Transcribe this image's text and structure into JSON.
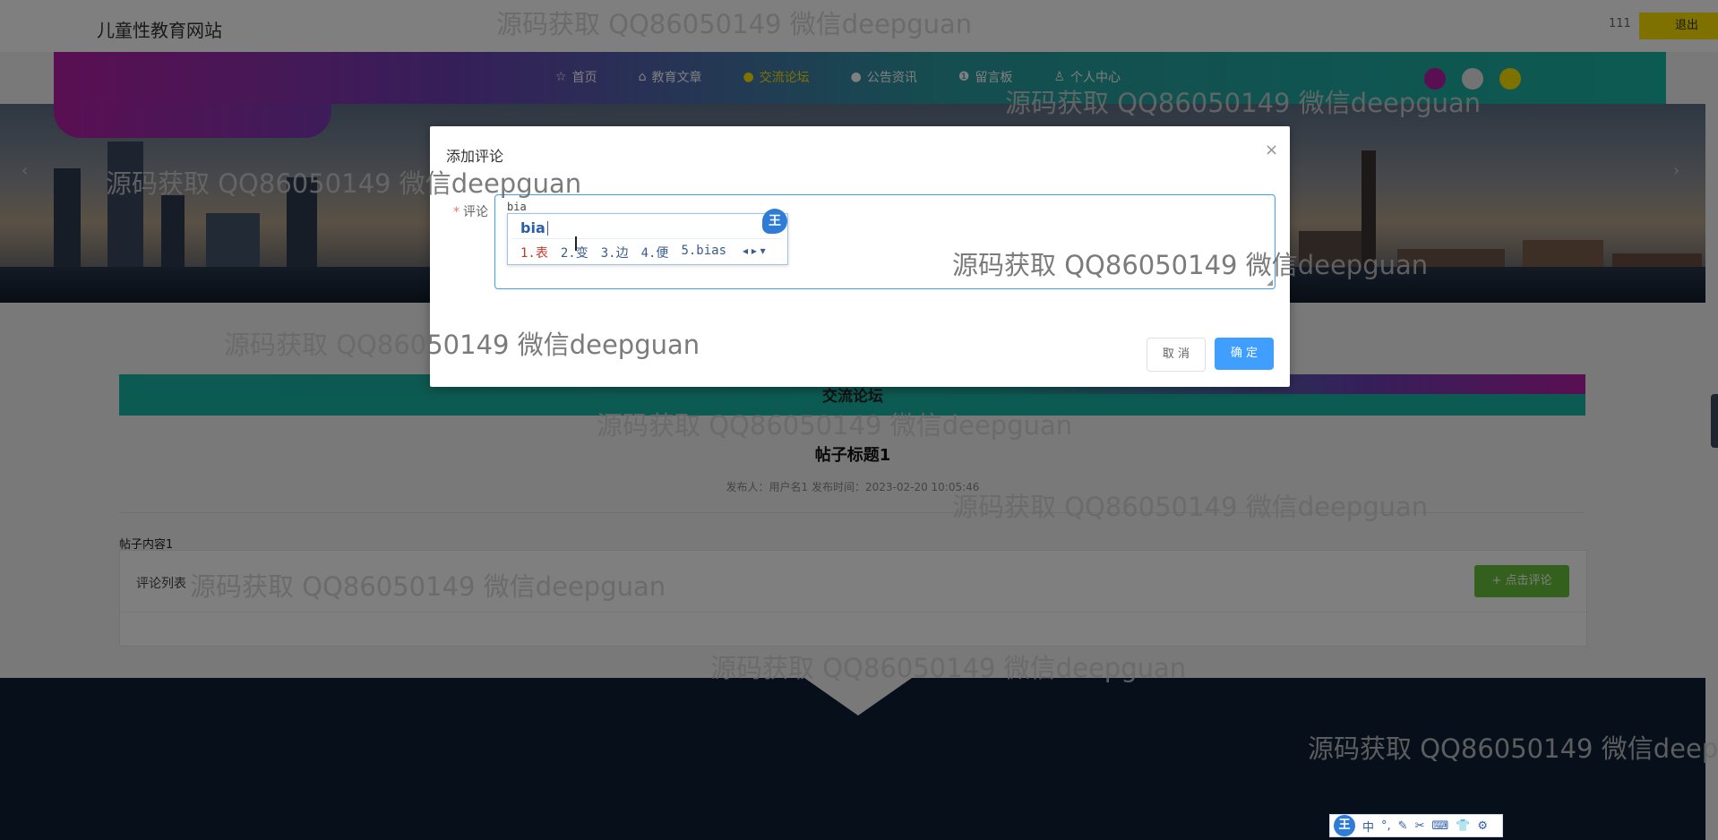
{
  "header": {
    "site_title": "儿童性教育网站",
    "username": "111",
    "logout_label": "退出"
  },
  "nav": {
    "items": [
      {
        "label": "首页",
        "icon": "star-icon"
      },
      {
        "label": "教育文章",
        "icon": "bag-icon"
      },
      {
        "label": "交流论坛",
        "icon": "circle-icon",
        "active": true
      },
      {
        "label": "公告资讯",
        "icon": "circle-icon"
      },
      {
        "label": "留言板",
        "icon": "info-icon"
      },
      {
        "label": "个人中心",
        "icon": "user-icon"
      }
    ],
    "theme_dots": [
      "#b41fa6",
      "#e6e6e6",
      "#ffe200"
    ]
  },
  "banner": {
    "prev_arrow": "‹",
    "next_arrow": "›"
  },
  "forum": {
    "section_title": "交流论坛",
    "post_title": "帖子标题1",
    "meta": "发布人：用户名1  发布时间：2023-02-20 10:05:46",
    "content": "帖子内容1",
    "comment_list_label": "评论列表",
    "comment_button": "+ 点击评论"
  },
  "dialog": {
    "title": "添加评论",
    "close": "×",
    "field_label": "评论",
    "required_mark": "*",
    "textarea_value": "bia",
    "cancel_label": "取 消",
    "confirm_label": "确 定"
  },
  "ime": {
    "composition": "bia",
    "badge": "王",
    "candidates": [
      "1.表",
      "2.变",
      "3.边",
      "4.便",
      "5.bias"
    ],
    "page_arrows": "◂ ▸ ▾"
  },
  "ime_toolbar": {
    "logo": "王",
    "items": [
      "中",
      "°,",
      "✎",
      "✂",
      "⌨",
      "👕",
      "⚙"
    ]
  },
  "watermark": {
    "text": "源码获取 QQ86050149 微信deepguan",
    "clipped_text": "源码获取 QQ86050149 微信deep"
  },
  "colors": {
    "accent_yellow": "#ffe200",
    "primary_blue": "#409eff",
    "success_green": "#67c23a",
    "footer_navy": "#0f1f36"
  }
}
